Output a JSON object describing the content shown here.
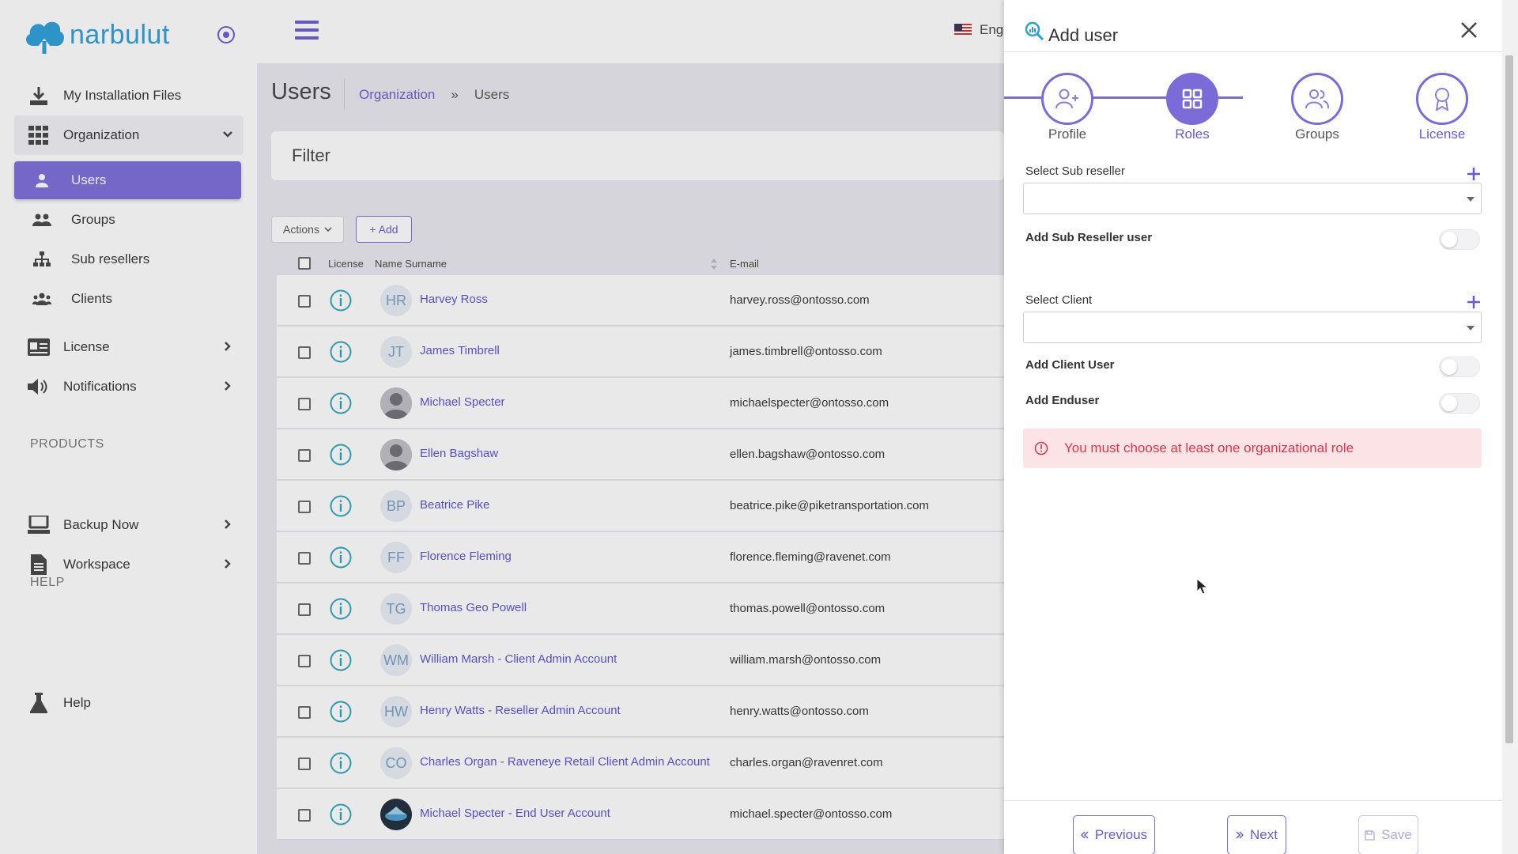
{
  "brand": {
    "name": "narbulut",
    "color": "#2a9fd8",
    "accent": "#7b6bd8"
  },
  "sidebar": {
    "items": [
      {
        "label": "My Installation Files",
        "icon": "download-icon"
      },
      {
        "label": "Organization",
        "icon": "grid-icon"
      },
      {
        "label": "Users",
        "icon": "user-icon"
      },
      {
        "label": "Groups",
        "icon": "users-icon"
      },
      {
        "label": "Sub resellers",
        "icon": "sitemap-icon"
      },
      {
        "label": "Clients",
        "icon": "clients-icon"
      },
      {
        "label": "License",
        "icon": "id-card-icon"
      },
      {
        "label": "Notifications",
        "icon": "volume-icon"
      },
      {
        "label": "Backup Now",
        "icon": "desktop-icon"
      },
      {
        "label": "Workspace",
        "icon": "file-icon"
      },
      {
        "label": "Help",
        "icon": "flask-icon"
      }
    ],
    "sections": {
      "products": "PRODUCTS",
      "help": "HELP"
    }
  },
  "topbar": {
    "language": "Eng"
  },
  "page": {
    "title": "Users",
    "breadcrumb": {
      "link": "Organization",
      "separator": "»",
      "current": "Users"
    },
    "filter_title": "Filter",
    "actions_label": "Actions",
    "add_label": "+ Add"
  },
  "table": {
    "headers": {
      "license": "License",
      "name": "Name Surname",
      "email": "E-mail"
    },
    "rows": [
      {
        "initials": "HR",
        "name": "Harvey Ross",
        "email": "harvey.ross@ontosso.com"
      },
      {
        "initials": "JT",
        "name": "James Timbrell",
        "email": "james.timbrell@ontosso.com"
      },
      {
        "initials": "",
        "name": "Michael Specter",
        "email": "michaelspecter@ontosso.com"
      },
      {
        "initials": "",
        "name": "Ellen Bagshaw",
        "email": "ellen.bagshaw@ontosso.com"
      },
      {
        "initials": "BP",
        "name": "Beatrice Pike",
        "email": "beatrice.pike@piketransportation.com"
      },
      {
        "initials": "FF",
        "name": "Florence Fleming",
        "email": "florence.fleming@ravenet.com"
      },
      {
        "initials": "TG",
        "name": "Thomas Geo Powell",
        "email": "thomas.powell@ontosso.com"
      },
      {
        "initials": "WM",
        "name": "William Marsh - Client Admin Account",
        "email": "william.marsh@ontosso.com"
      },
      {
        "initials": "HW",
        "name": "Henry Watts - Reseller Admin Account",
        "email": "henry.watts@ontosso.com"
      },
      {
        "initials": "CO",
        "name": "Charles Organ - Raveneye Retail Client Admin Account",
        "email": "charles.organ@ravenret.com"
      },
      {
        "initials": "",
        "name": "Michael Specter - End User Account",
        "email": "michael.specter@ontosso.com"
      }
    ]
  },
  "panel": {
    "title": "Add user",
    "steps": [
      {
        "label": "Profile",
        "icon": "user-plus-icon"
      },
      {
        "label": "Roles",
        "icon": "grid-icon"
      },
      {
        "label": "Groups",
        "icon": "users-icon"
      },
      {
        "label": "License",
        "icon": "award-icon"
      }
    ],
    "active_step": "Roles",
    "select_sub_reseller_label": "Select Sub reseller",
    "add_sub_reseller_user_label": "Add Sub Reseller user",
    "select_client_label": "Select Client",
    "add_client_user_label": "Add Client User",
    "add_enduser_label": "Add Enduser",
    "alert_text": "You must choose at least one organizational role",
    "buttons": {
      "previous": "Previous",
      "next": "Next",
      "save": "Save"
    }
  }
}
